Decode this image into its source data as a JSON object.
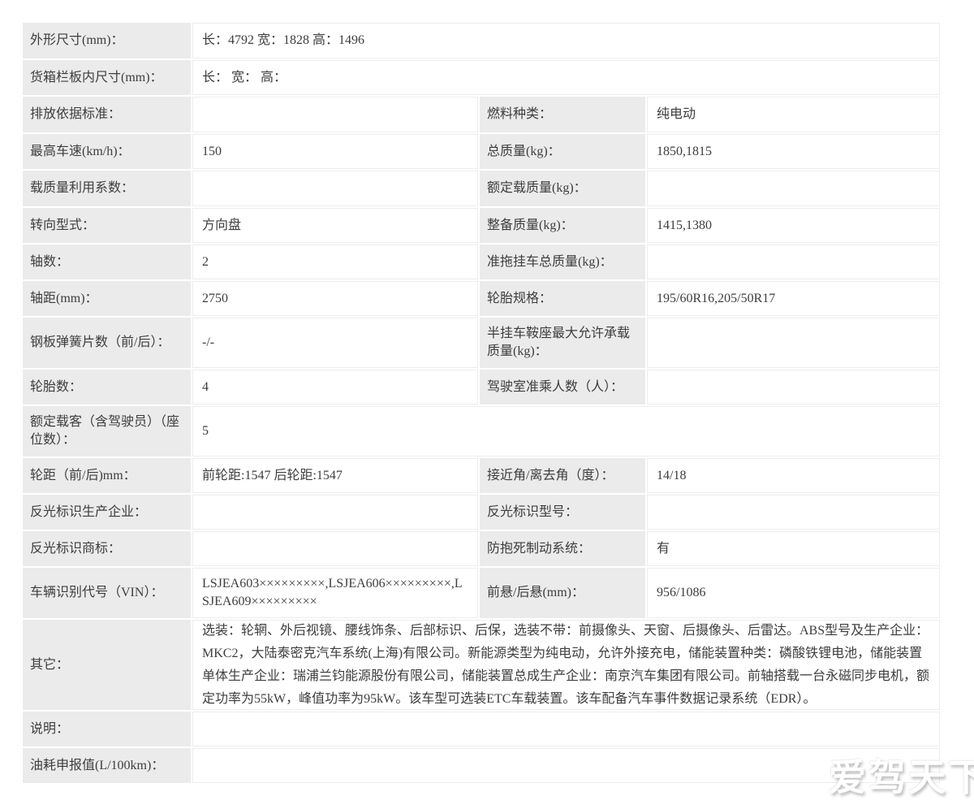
{
  "colors": {
    "label_cell_bg": "#ebebeb",
    "value_cell_border": "#ededed",
    "text": "#3d3d3d",
    "watermark": "#ffffff"
  },
  "watermark": {
    "text": "爱驾天下"
  },
  "table": {
    "rows": [
      {
        "span": "full",
        "cells": [
          {
            "label": "外形尺寸(mm)：",
            "value": "长：4792 宽：1828 高：1496"
          }
        ]
      },
      {
        "span": "full",
        "cells": [
          {
            "label": "货箱栏板内尺寸(mm)：",
            "value": "长： 宽： 高："
          }
        ]
      },
      {
        "span": "half",
        "cells": [
          {
            "label": "排放依据标准：",
            "value": ""
          },
          {
            "label": "燃料种类：",
            "value": "纯电动"
          }
        ]
      },
      {
        "span": "half",
        "cells": [
          {
            "label": "最高车速(km/h)：",
            "value": "150"
          },
          {
            "label": "总质量(kg)：",
            "value": "1850,1815"
          }
        ]
      },
      {
        "span": "half",
        "cells": [
          {
            "label": "载质量利用系数：",
            "value": ""
          },
          {
            "label": "额定载质量(kg)：",
            "value": ""
          }
        ]
      },
      {
        "span": "half",
        "cells": [
          {
            "label": "转向型式：",
            "value": "方向盘"
          },
          {
            "label": "整备质量(kg)：",
            "value": "1415,1380"
          }
        ]
      },
      {
        "span": "half",
        "cells": [
          {
            "label": "轴数：",
            "value": "2"
          },
          {
            "label": "准拖挂车总质量(kg)：",
            "value": ""
          }
        ]
      },
      {
        "span": "half",
        "cells": [
          {
            "label": "轴距(mm)：",
            "value": "2750"
          },
          {
            "label": "轮胎规格：",
            "value": "195/60R16,205/50R17"
          }
        ]
      },
      {
        "span": "half",
        "cells": [
          {
            "label": "钢板弹簧片数（前/后）：",
            "value": "-/-"
          },
          {
            "label": "半挂车鞍座最大允许承载质量(kg)：",
            "value": ""
          }
        ]
      },
      {
        "span": "half",
        "cells": [
          {
            "label": "轮胎数：",
            "value": "4"
          },
          {
            "label": "驾驶室准乘人数（人）：",
            "value": ""
          }
        ]
      },
      {
        "span": "full",
        "cells": [
          {
            "label": "额定载客（含驾驶员）（座位数）：",
            "value": "5"
          }
        ]
      },
      {
        "span": "half",
        "cells": [
          {
            "label": "轮距（前/后)mm：",
            "value": "前轮距:1547 后轮距:1547"
          },
          {
            "label": "接近角/离去角（度）：",
            "value": "14/18"
          }
        ]
      },
      {
        "span": "half",
        "cells": [
          {
            "label": "反光标识生产企业：",
            "value": ""
          },
          {
            "label": "反光标识型号：",
            "value": ""
          }
        ]
      },
      {
        "span": "half",
        "cells": [
          {
            "label": "反光标识商标：",
            "value": ""
          },
          {
            "label": "防抱死制动系统：",
            "value": "有"
          }
        ]
      },
      {
        "span": "half",
        "cells": [
          {
            "label": "车辆识别代号（VIN）：",
            "value": "LSJEA603×××××××××,LSJEA606×××××××××,LSJEA609×××××××××"
          },
          {
            "label": "前悬/后悬(mm)：",
            "value": "956/1086"
          }
        ]
      },
      {
        "span": "full",
        "para": true,
        "cells": [
          {
            "label": "其它：",
            "value": "选装：轮辋、外后视镜、腰线饰条、后部标识、后保，选装不带：前摄像头、天窗、后摄像头、后雷达。ABS型号及生产企业：MKC2，大陆泰密克汽车系统(上海)有限公司。新能源类型为纯电动，允许外接充电，储能装置种类：磷酸铁锂电池，储能装置单体生产企业：瑞浦兰钧能源股份有限公司，储能装置总成生产企业：南京汽车集团有限公司。前轴搭载一台永磁同步电机，额定功率为55kW，峰值功率为95kW。该车型可选装ETC车载装置。该车配备汽车事件数据记录系统（EDR）。"
          }
        ]
      },
      {
        "span": "full",
        "cells": [
          {
            "label": "说明：",
            "value": ""
          }
        ]
      },
      {
        "span": "full",
        "cells": [
          {
            "label": "油耗申报值(L/100km)：",
            "value": ""
          }
        ]
      }
    ]
  }
}
